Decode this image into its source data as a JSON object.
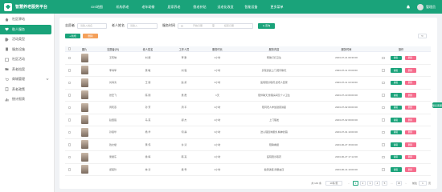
{
  "app": {
    "title": "智慧养老服务平台"
  },
  "nav": [
    "GIS地图",
    "机构养老",
    "老年助餐",
    "居家养老",
    "慰老补贴",
    "适老化改造",
    "智能设备",
    "更多菜单"
  ],
  "user": {
    "name": "管理员"
  },
  "sidebar": [
    {
      "label": "社区驿站",
      "icon": "home-icon"
    },
    {
      "label": "助人服务",
      "icon": "heart-icon",
      "active": true
    },
    {
      "label": "活动类型",
      "icon": "tag-icon"
    },
    {
      "label": "服务设施",
      "icon": "building-icon"
    },
    {
      "label": "社区活动",
      "icon": "calendar-icon"
    },
    {
      "label": "养老档案",
      "icon": "folder-icon"
    },
    {
      "label": "商城管理",
      "icon": "cart-icon",
      "expandable": true
    },
    {
      "label": "养老政策",
      "icon": "document-icon"
    },
    {
      "label": "统计报表",
      "icon": "chart-icon"
    }
  ],
  "filters": {
    "elder_label": "志愿者",
    "elder_placeholder": "请输入姓名",
    "staff_label": "老人姓名",
    "staff_placeholder": "请输入",
    "time_label": "服务时间",
    "start_placeholder": "开始日期",
    "sep": "至",
    "end_placeholder": "结束日期",
    "search_label": "Q 查询"
  },
  "actions": {
    "add_label": "+ 新增",
    "delete_label": "删除",
    "refresh_label": "↻"
  },
  "table": {
    "headers": [
      "图片",
      "志愿者(ID)",
      "老人姓名",
      "工作人员",
      "服务时长",
      "服务内容",
      "服务时间",
      "操作"
    ],
    "rows": [
      {
        "name": "王晓琳",
        "elder": "刘 顺",
        "staff": "李 鹏",
        "duration": "2小时",
        "content": "帮助打扫卫生",
        "time": "2023-07-21 09:30:00"
      },
      {
        "name": "李海军",
        "elder": "吴 敏",
        "staff": "刘 强",
        "duration": "1小时",
        "content": "买菜送饭上门,陪同聊天",
        "time": "2023-07-11 15:00:00"
      },
      {
        "name": "刘海涛",
        "elder": "王 丽",
        "staff": "赵 勇",
        "duration": "3小时",
        "content": "医院陪诊取药,送老人回家",
        "time": "2023-07-11 10:30:00"
      },
      {
        "name": "张宏飞",
        "elder": "陈 刚",
        "staff": "吴 霞",
        "duration": "1天",
        "content": "陪伴聊天,整理房间及个人卫生",
        "time": "2023-07-10 09:00:00"
      },
      {
        "name": "周晓燕",
        "elder": "孙 芳",
        "staff": "周 平",
        "duration": "2小时",
        "content": "陪同老人参加健康讲座",
        "time": "2023-07-02 09:00:00"
      },
      {
        "name": "赵国强",
        "elder": "马 英",
        "staff": "郑 杰",
        "duration": "2小时",
        "content": "上门理发",
        "time": "2023-07-02 09:00:00"
      },
      {
        "name": "孙丽华",
        "elder": "杨 华",
        "staff": "何 静",
        "duration": "3小时",
        "content": "送心理咨询服务,精神慰藉",
        "time": "2023-07-01 10:00:00"
      },
      {
        "name": "钱文斌",
        "elder": "黄 伟",
        "staff": "许 涛",
        "duration": "2小时",
        "content": "陪聊看报",
        "time": "2023-06-27 15:00:00"
      },
      {
        "name": "吴振东",
        "elder": "徐 梅",
        "staff": "韩 亮",
        "duration": "2小时",
        "content": "医院陪诊取药",
        "time": "2023-06-27 17:12:00"
      },
      {
        "name": "郑美玲",
        "elder": "林 涛",
        "staff": "梁 雪",
        "duration": "2小时",
        "content": "健康讲座,测量血压",
        "time": "2023-06-14 10:00:00"
      }
    ],
    "edit_label": "编辑",
    "delete_label": "删除"
  },
  "pagination": {
    "total": "共 143 条",
    "page_size": "10条/页",
    "pages": [
      "1",
      "2",
      "3",
      "4",
      "5",
      "...",
      "15"
    ],
    "current": "1",
    "goto_label": "前往",
    "goto_value": "1",
    "page_suffix": "页"
  },
  "float_tab": "联系客服",
  "colors": {
    "primary": "#1aa37a",
    "warning": "#f4a05a",
    "danger": "#f56c8c"
  }
}
